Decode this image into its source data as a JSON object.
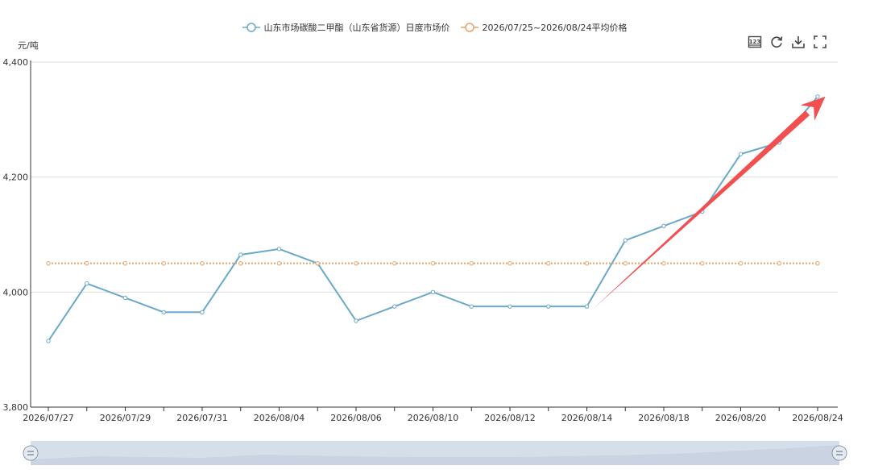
{
  "chart_data": {
    "type": "line",
    "unit_label": "元/吨",
    "ylim": [
      3800,
      4400
    ],
    "yticks": [
      3800,
      4000,
      4200,
      4400
    ],
    "ytick_labels": [
      "3,800",
      "4,000",
      "4,200",
      "4,400"
    ],
    "x": [
      "2026/07/27",
      "2026/07/28",
      "2026/07/29",
      "2026/07/30",
      "2026/07/31",
      "2026/08/03",
      "2026/08/04",
      "2026/08/05",
      "2026/08/06",
      "2026/08/07",
      "2026/08/10",
      "2026/08/11",
      "2026/08/12",
      "2026/08/13",
      "2026/08/14",
      "2026/08/17",
      "2026/08/18",
      "2026/08/19",
      "2026/08/20",
      "2026/08/21",
      "2026/08/24"
    ],
    "xtick_labels": [
      "2026/07/27",
      "2026/07/29",
      "2026/07/31",
      "2026/08/04",
      "2026/08/06",
      "2026/08/10",
      "2026/08/12",
      "2026/08/14",
      "2026/08/18",
      "2026/08/20",
      "2026/08/24"
    ],
    "series": [
      {
        "name": "山东市场碳酸二甲酯（山东省货源）日度市场价",
        "color": "#6aa9c9",
        "style": "solid",
        "values": [
          3915,
          4015,
          3990,
          3965,
          3965,
          4065,
          4075,
          4050,
          3950,
          3975,
          4000,
          3975,
          3975,
          3975,
          3975,
          4090,
          4115,
          4140,
          4240,
          4260,
          4340
        ]
      },
      {
        "name": "2026/07/25~2026/08/24平均价格",
        "color": "#e8a36a",
        "style": "dotted",
        "values": [
          4050,
          4050,
          4050,
          4050,
          4050,
          4050,
          4050,
          4050,
          4050,
          4050,
          4050,
          4050,
          4050,
          4050,
          4050,
          4050,
          4050,
          4050,
          4050,
          4050,
          4050
        ]
      }
    ],
    "annotation": {
      "type": "arrow",
      "color": "#f25050",
      "from_index": 14.15,
      "from_value": 3970,
      "to_index": 20.2,
      "to_value": 4340
    },
    "grid": true,
    "legend_position": "top-center"
  },
  "toolbox": {
    "icons": [
      "data-view-icon",
      "refresh-icon",
      "download-icon",
      "fullscreen-icon"
    ]
  },
  "colors": {
    "axis": "#333333",
    "grid": "#dddddd",
    "slider_fill": "#d5dee9",
    "slider_handle": "#e6ebf2"
  }
}
